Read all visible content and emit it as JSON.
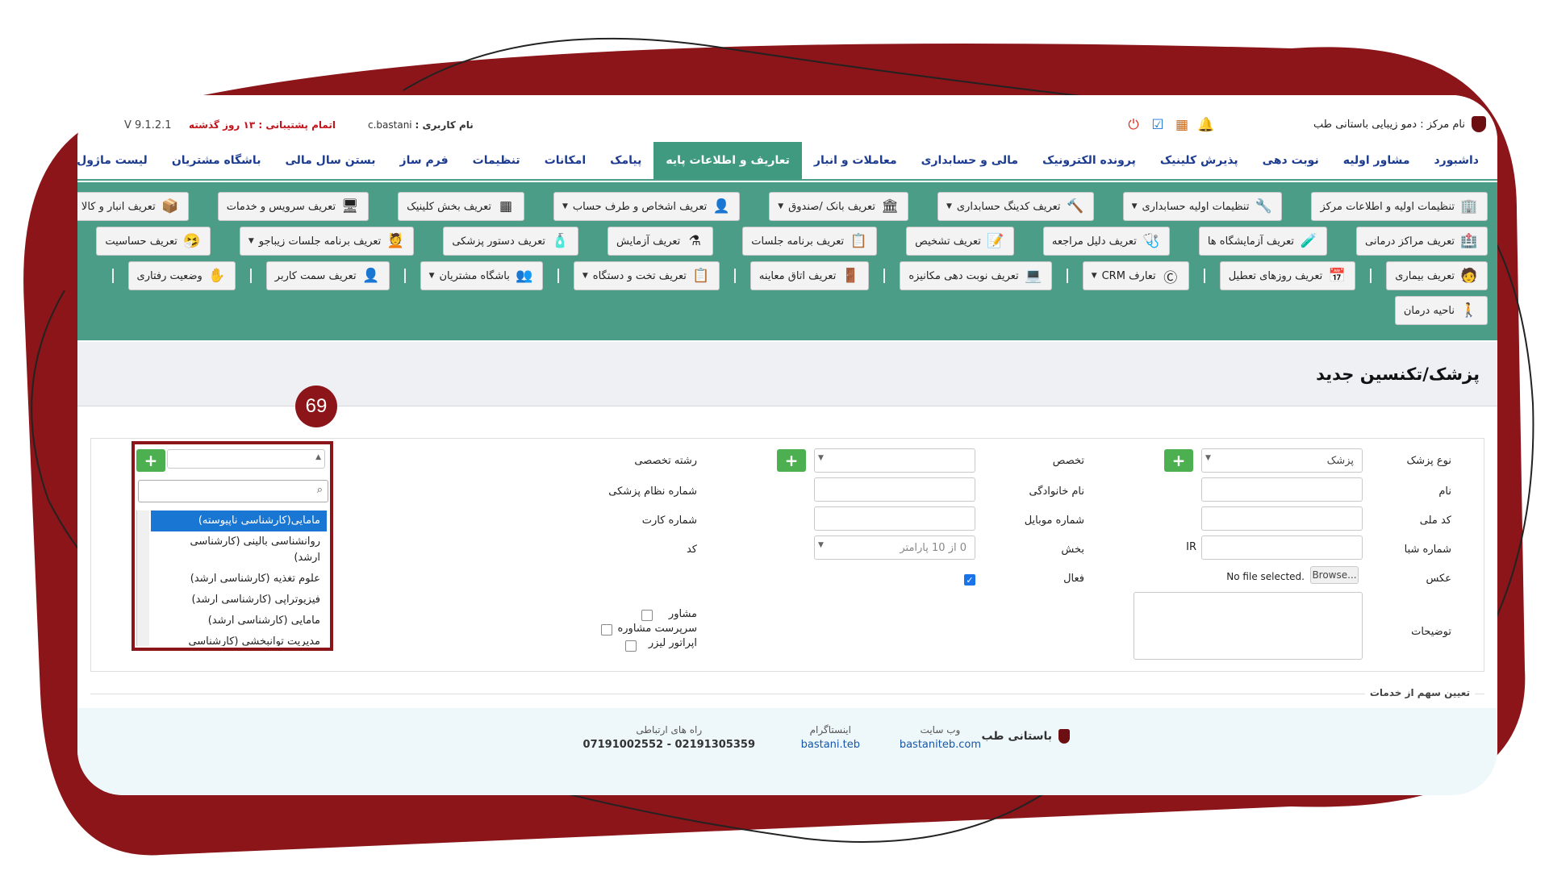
{
  "topbar": {
    "center_label": "نام مرکز :",
    "center_value": "دمو زیبایی باستانی طب",
    "user_label": "نام کاربری :",
    "user_value": "c.bastani",
    "support": "اتمام پشتیبانی : ۱۳ روز گذشته",
    "version": "V 9.1.2.1",
    "icons": [
      "power-icon",
      "calendar-check-icon",
      "calendar-icon",
      "bell-icon"
    ]
  },
  "menu": {
    "items": [
      "داشبورد",
      "مشاور اولیه",
      "نوبت دهی",
      "پذیرش کلینیک",
      "پرونده الکترونیک",
      "مالی و حسابداری",
      "معاملات و انبار",
      "تعاریف و اطلاعات پایه",
      "پیامک",
      "امکانات",
      "تنظیمات",
      "فرم ساز",
      "بستن سال مالی",
      "باشگاه مشتریان",
      "لیست ماژول ها"
    ],
    "active": "تعاریف و اطلاعات پایه"
  },
  "submenu": {
    "row1": [
      {
        "label": "تنظیمات اولیه و اطلاعات مرکز",
        "icon": "building-icon",
        "caret": false
      },
      {
        "label": "تنظیمات اولیه حسابداری",
        "icon": "tools-icon",
        "caret": true
      },
      {
        "label": "تعریف کدینگ حسابداری",
        "icon": "hammer-icon",
        "caret": true
      },
      {
        "label": "تعریف بانک /صندوق",
        "icon": "bank-icon",
        "caret": true
      },
      {
        "label": "تعریف اشخاص و طرف حساب",
        "icon": "person-icon",
        "caret": true
      },
      {
        "label": "تعریف بخش کلینیک",
        "icon": "grid-icon",
        "caret": false
      },
      {
        "label": "تعریف سرویس و خدمات",
        "icon": "monitor-icon",
        "caret": false
      },
      {
        "label": "تعریف انبار و کالا",
        "icon": "box-icon",
        "caret": true
      }
    ],
    "row2": [
      {
        "label": "تعریف مراکز درمانی",
        "icon": "hospital-icon",
        "caret": false
      },
      {
        "label": "تعریف آزمایشگاه ها",
        "icon": "lab-icon",
        "caret": false
      },
      {
        "label": "تعریف دلیل مراجعه",
        "icon": "doctor-icon",
        "caret": false
      },
      {
        "label": "تعریف تشخیص",
        "icon": "note-icon",
        "caret": false
      },
      {
        "label": "تعریف برنامه جلسات",
        "icon": "checklist-icon",
        "caret": false
      },
      {
        "label": "تعریف آزمایش",
        "icon": "flask-icon",
        "caret": false
      },
      {
        "label": "تعریف دستور پزشکی",
        "icon": "bottle-icon",
        "caret": false
      },
      {
        "label": "تعریف برنامه جلسات زیباجو",
        "icon": "beauty-icon",
        "caret": true
      },
      {
        "label": "تعریف حساسیت",
        "icon": "allergy-icon",
        "caret": false
      }
    ],
    "row3": [
      {
        "label": "تعریف بیماری",
        "icon": "patient-icon",
        "caret": false
      },
      {
        "label": "تعریف روزهای تعطیل",
        "icon": "calendar-icon",
        "caret": false
      },
      {
        "label": "تعارف CRM",
        "icon": "crm-icon",
        "caret": true
      },
      {
        "label": "تعریف نوبت دهی مکانیزه",
        "icon": "computer-icon",
        "caret": false
      },
      {
        "label": "تعریف اتاق معاینه",
        "icon": "room-icon",
        "caret": false
      },
      {
        "label": "تعریف تخت و دستگاه",
        "icon": "clipboard-icon",
        "caret": true
      },
      {
        "label": "باشگاه مشتریان",
        "icon": "group-icon",
        "caret": true
      },
      {
        "label": "تعریف سمت کاربر",
        "icon": "user-icon",
        "caret": false
      },
      {
        "label": "وضعیت رفتاری",
        "icon": "hand-icon",
        "caret": false
      }
    ],
    "row4": [
      {
        "label": "ناحیه درمان",
        "icon": "body-icon",
        "caret": false
      }
    ]
  },
  "page": {
    "title": "پزشک/تکنسین جدید",
    "badge": "69"
  },
  "form": {
    "doctor_type_label": "نوع پزشک",
    "doctor_type_value": "پزشک",
    "specialty_label": "تخصص",
    "field_label": "رشته تخصصی",
    "name_label": "نام",
    "family_label": "نام خانوادگی",
    "license_label": "شماره نظام پزشکی",
    "national_label": "کد ملی",
    "mobile_label": "شماره موبایل",
    "card_label": "شماره کارت",
    "sheba_label": "شماره شبا",
    "sheba_prefix": "IR",
    "dept_label": "بخش",
    "dept_value": "0 از 10 پارامتر",
    "code_label": "کد",
    "photo_label": "عکس",
    "browse": "Browse...",
    "no_file": "No file selected.",
    "active_label": "فعال",
    "notes_label": "توضیحات",
    "consultant_label": "مشاور",
    "supervisor_label": "سرپرست مشاوره",
    "laser_label": "اپراتور لیزر",
    "plus": "+"
  },
  "dropdown": {
    "options": [
      "مامایی(کارشناسی ناپیوسته)",
      "روانشناسی بالینی (کارشناسی ارشد)",
      "علوم تغذیه (کارشناسی ارشد)",
      "فیزیوتراپی (کارشناسی ارشد)",
      "مامایی (کارشناسی ارشد)",
      "مدیریت توانبخشی (کارشناسی ارشد)"
    ],
    "selected_index": 0
  },
  "share": {
    "title": "تعیین سهم از خدمات"
  },
  "footer": {
    "brand": "باستانی طب",
    "website_label": "وب سایت",
    "website": "bastaniteb.com",
    "instagram_label": "اینستاگرام",
    "instagram": "bastani.teb",
    "contact_label": "راه های ارتباطی",
    "contact": "07191002552 - 02191305359"
  },
  "colors": {
    "accent": "#4c9d87",
    "frame": "#8b1519",
    "menu_text": "#1d3c8f"
  }
}
